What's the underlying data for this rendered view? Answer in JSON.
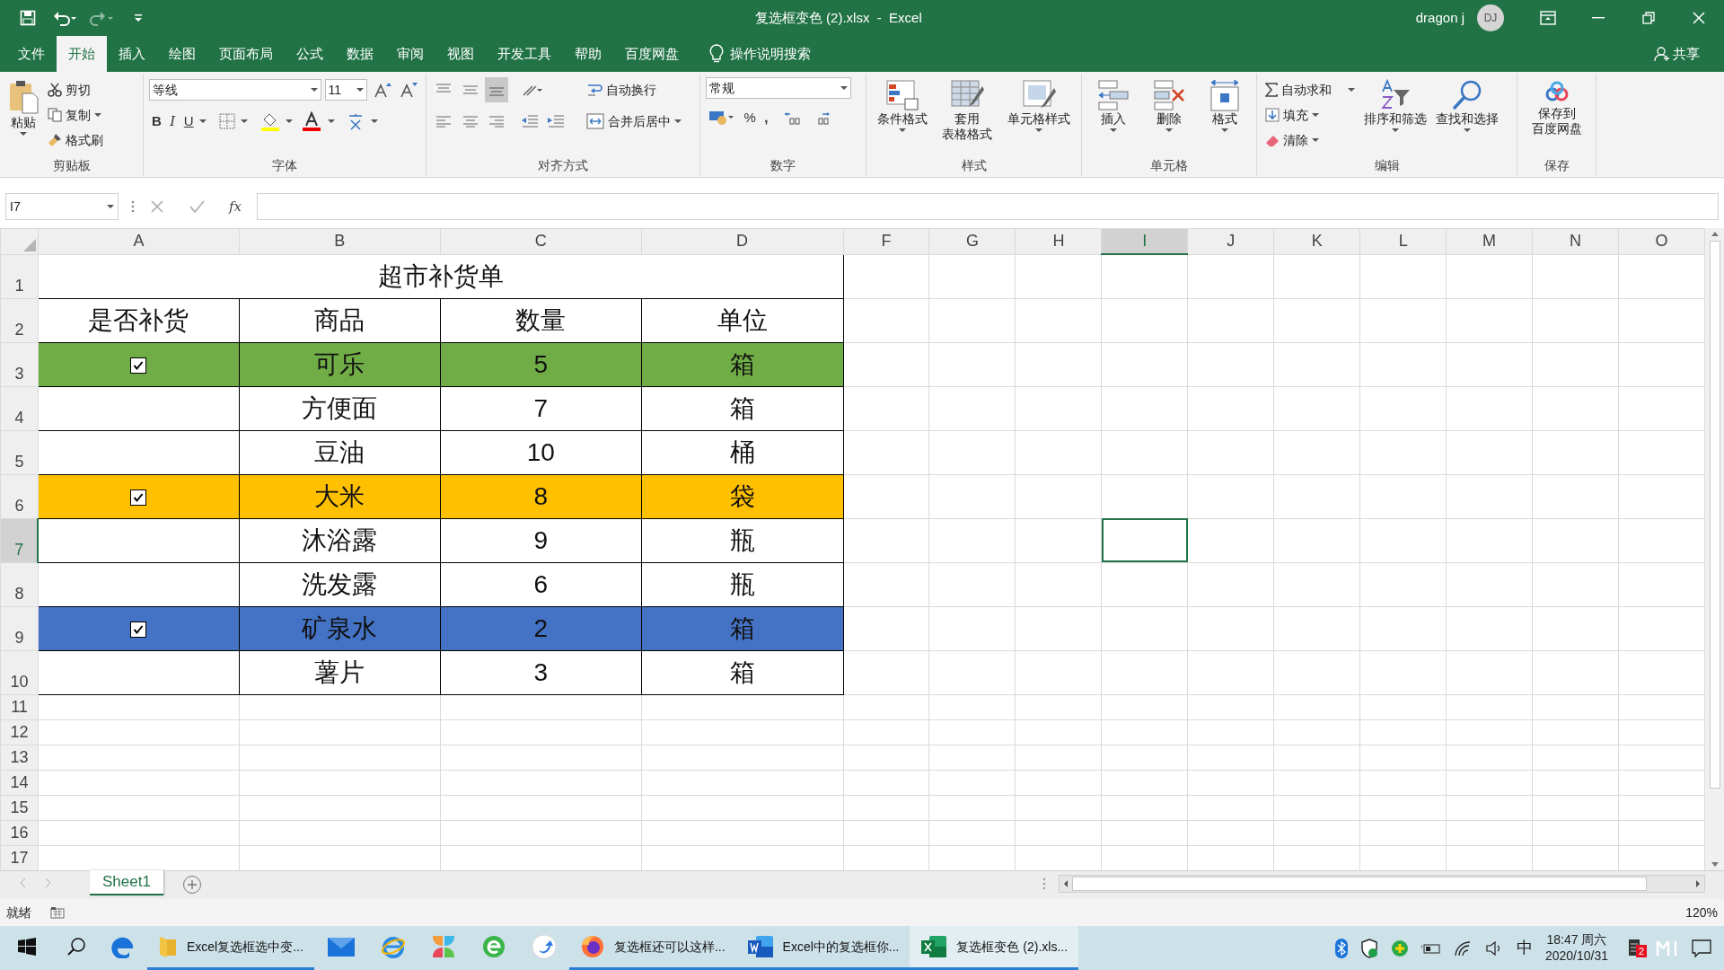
{
  "window": {
    "title": "复选框变色 (2).xlsx  -  Excel",
    "user": "dragon j",
    "avatar": "DJ"
  },
  "menu_tabs": [
    {
      "label": "文件",
      "selected": false
    },
    {
      "label": "开始",
      "selected": true
    },
    {
      "label": "插入",
      "selected": false
    },
    {
      "label": "绘图",
      "selected": false
    },
    {
      "label": "页面布局",
      "selected": false
    },
    {
      "label": "公式",
      "selected": false
    },
    {
      "label": "数据",
      "selected": false
    },
    {
      "label": "审阅",
      "selected": false
    },
    {
      "label": "视图",
      "selected": false
    },
    {
      "label": "开发工具",
      "selected": false
    },
    {
      "label": "帮助",
      "selected": false
    },
    {
      "label": "百度网盘",
      "selected": false
    }
  ],
  "tell_me": "操作说明搜索",
  "share": "共享",
  "ribbon": {
    "paste": "粘贴",
    "cut": "剪切",
    "copy": "复制",
    "painter": "格式刷",
    "clipboard": "剪贴板",
    "font_name": "等线",
    "font_size": "11",
    "bold": "B",
    "italic": "I",
    "underline": "U",
    "font": "字体",
    "wrap": "自动换行",
    "merge": "合并后居中",
    "alignment": "对齐方式",
    "number_format": "常规",
    "percent": "%",
    "comma": ",",
    "number": "数字",
    "cond_format": "条件格式",
    "table_format_1": "套用",
    "table_format_2": "表格格式",
    "cell_styles": "单元格样式",
    "styles": "样式",
    "insert": "插入",
    "delete": "删除",
    "format": "格式",
    "cells": "单元格",
    "autosum": "自动求和",
    "fill": "填充",
    "clear": "清除",
    "sort": "排序和筛选",
    "find": "查找和选择",
    "editing": "编辑",
    "save_1": "保存到",
    "save_2": "百度网盘",
    "save": "保存"
  },
  "formula_bar": {
    "name_box": "I7",
    "fx": "fx"
  },
  "sheet": {
    "columns": [
      {
        "label": "A",
        "selected": false
      },
      {
        "label": "B",
        "selected": false
      },
      {
        "label": "C",
        "selected": false
      },
      {
        "label": "D",
        "selected": false
      },
      {
        "label": "F",
        "selected": false
      },
      {
        "label": "G",
        "selected": false
      },
      {
        "label": "H",
        "selected": false
      },
      {
        "label": "I",
        "selected": true
      },
      {
        "label": "J",
        "selected": false
      },
      {
        "label": "K",
        "selected": false
      },
      {
        "label": "L",
        "selected": false
      },
      {
        "label": "M",
        "selected": false
      },
      {
        "label": "N",
        "selected": false
      },
      {
        "label": "O",
        "selected": false
      }
    ],
    "rows": [
      {
        "label": "1",
        "selected": false
      },
      {
        "label": "2",
        "selected": false
      },
      {
        "label": "3",
        "selected": false
      },
      {
        "label": "4",
        "selected": false
      },
      {
        "label": "5",
        "selected": false
      },
      {
        "label": "6",
        "selected": false
      },
      {
        "label": "7",
        "selected": true
      },
      {
        "label": "8",
        "selected": false
      },
      {
        "label": "9",
        "selected": false
      },
      {
        "label": "10",
        "selected": false
      },
      {
        "label": "11",
        "selected": false
      },
      {
        "label": "12",
        "selected": false
      },
      {
        "label": "13",
        "selected": false
      },
      {
        "label": "14",
        "selected": false
      },
      {
        "label": "15",
        "selected": false
      },
      {
        "label": "16",
        "selected": false
      },
      {
        "label": "17",
        "selected": false
      }
    ],
    "title": "超市补货单",
    "headers": [
      "是否补货",
      "商品",
      "数量",
      "单位"
    ],
    "items": [
      {
        "checked": true,
        "product": "可乐",
        "qty": "5",
        "unit": "箱",
        "color": "#70ad47"
      },
      {
        "checked": false,
        "product": "方便面",
        "qty": "7",
        "unit": "箱"
      },
      {
        "checked": false,
        "product": "豆油",
        "qty": "10",
        "unit": "桶"
      },
      {
        "checked": true,
        "product": "大米",
        "qty": "8",
        "unit": "袋",
        "color": "#ffc000"
      },
      {
        "checked": false,
        "product": "沐浴露",
        "qty": "9",
        "unit": "瓶"
      },
      {
        "checked": false,
        "product": "洗发露",
        "qty": "6",
        "unit": "瓶"
      },
      {
        "checked": true,
        "product": "矿泉水",
        "qty": "2",
        "unit": "箱",
        "color": "#4472c4"
      },
      {
        "checked": false,
        "product": "薯片",
        "qty": "3",
        "unit": "箱"
      }
    ]
  },
  "sheet_tabs": [
    {
      "label": "Sheet1",
      "selected": true
    }
  ],
  "status": {
    "text": "就绪",
    "zoom": "120%"
  },
  "taskbar": {
    "items": [
      {
        "kind": "start",
        "running": false,
        "active": false
      },
      {
        "kind": "search",
        "running": false,
        "active": false
      },
      {
        "kind": "edge",
        "running": false,
        "active": false
      },
      {
        "kind": "folder",
        "label": "Excel复选框选中变...",
        "running": true,
        "active": false
      },
      {
        "kind": "mail",
        "running": false,
        "active": false
      },
      {
        "kind": "ie",
        "running": false,
        "active": false
      },
      {
        "kind": "tiles",
        "running": false,
        "active": false
      },
      {
        "kind": "globe",
        "running": false,
        "active": false
      },
      {
        "kind": "arrow",
        "running": false,
        "active": false
      },
      {
        "kind": "firefox",
        "label": "复选框还可以这样...",
        "running": true,
        "active": false
      },
      {
        "kind": "word",
        "label": "Excel中的复选框你...",
        "running": true,
        "active": false
      },
      {
        "kind": "excel",
        "label": "复选框变色 (2).xls...",
        "running": true,
        "active": true
      }
    ],
    "ime": "中",
    "time": "18:47 周六",
    "date": "2020/10/31",
    "badge": "2"
  }
}
